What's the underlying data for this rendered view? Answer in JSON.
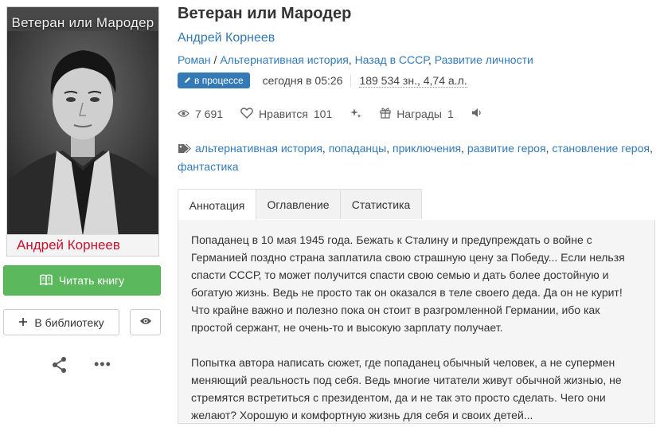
{
  "book": {
    "title": "Ветеран или Мародер",
    "author": "Андрей Корнеев",
    "genres": [
      "Роман",
      "Альтернативная история",
      "Назад в СССР",
      "Развитие личности"
    ],
    "status_badge": "в процессе",
    "updated": "сегодня в 05:26",
    "size": "189 534 зн., 4,74 а.л."
  },
  "cover": {
    "title_text": "Ветеран или Мародер",
    "author_text": "Андрей Корнеев"
  },
  "stats": {
    "views": "7 691",
    "likes_label": "Нравится",
    "likes": "101",
    "awards_label": "Награды",
    "awards": "1"
  },
  "tags": [
    "альтернативная история",
    "попаданцы",
    "приключения",
    "развитие героя",
    "становление героя",
    "фантастика"
  ],
  "actions": {
    "read": "Читать книгу",
    "library": "В библиотеку"
  },
  "tabs": [
    "Аннотация",
    "Оглавление",
    "Статистика"
  ],
  "annotation": {
    "p1": "Попаданец в 10 мая 1945 года. Бежать к Сталину и предупреждать о войне с Германией поздно страна заплатила свою страшную цену за Победу... Если нельзя спасти СССР, то может получится спасти свою семью и дать более достойную и богатую жизнь. Ведь не просто так он оказался в теле своего деда. Да он не курит! Что крайне важно и полезно пока он стоит в разгромленной Германии, ибо как простой сержант, не очень-то и высокую зарплату получает.",
    "p2": "Попытка автора написать сюжет, где попаданец обычный человек, а не супермен меняющий реальность под себя. Ведь многие читатели живут обычной жизнью, не стремятся встретиться с президентом, да и не так это просто сделать. Чего они желают? Хорошую и комфортную жизнь для себя и своих детей..."
  },
  "colors": {
    "link": "#337ab7",
    "read_button": "#5cb85c",
    "cover_author": "#c8102e"
  }
}
